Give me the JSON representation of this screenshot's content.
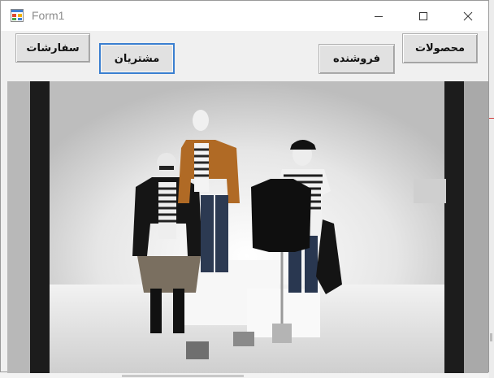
{
  "window": {
    "title": "Form1"
  },
  "buttons": {
    "orders": "سفارشات",
    "customers": "مشتریان",
    "seller": "فروشنده",
    "products": "محصولات"
  },
  "picture_box": {
    "description_icon": "mannequin-storefront-photo"
  },
  "colors": {
    "focus_border": "#3a7fd0",
    "form_background": "#f0f0f0",
    "button_face": "#e1e1e1"
  }
}
